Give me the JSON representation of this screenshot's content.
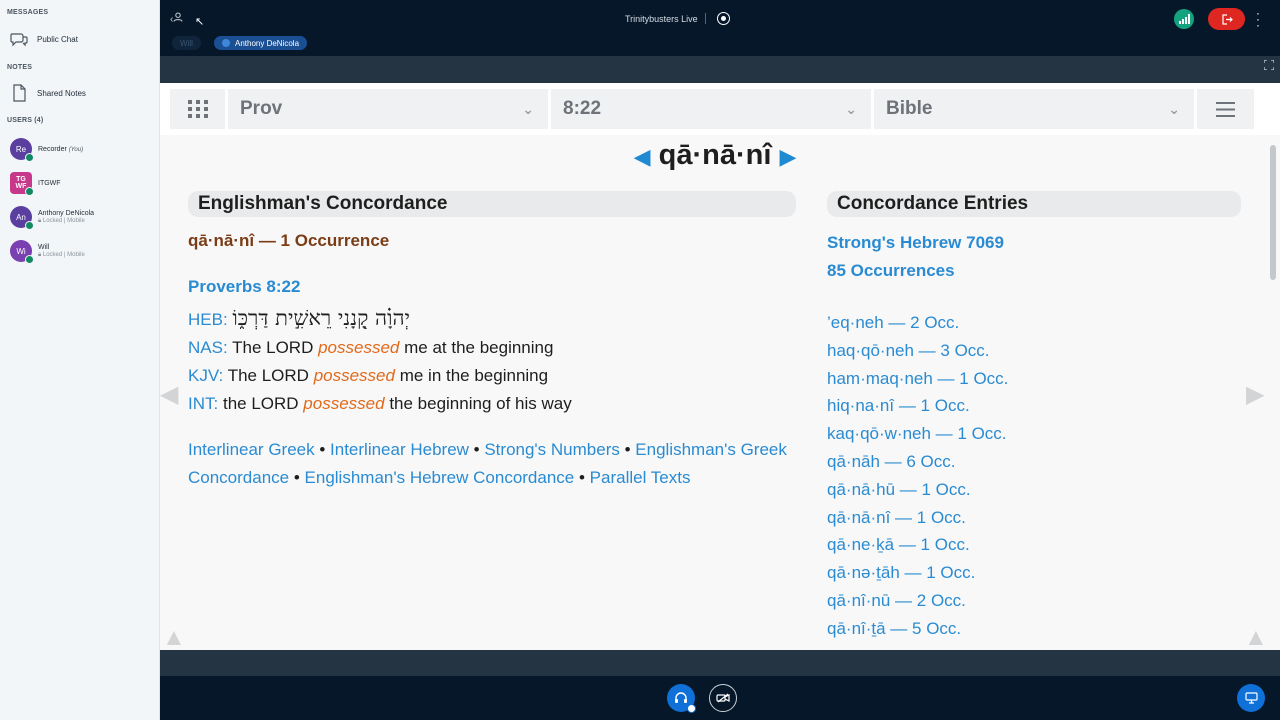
{
  "sidebar": {
    "messages_heading": "MESSAGES",
    "public_chat": "Public Chat",
    "notes_heading": "NOTES",
    "shared_notes": "Shared Notes",
    "users_heading": "USERS (4)",
    "users": [
      {
        "initials": "Re",
        "name": "Recorder",
        "tag": "(You)",
        "status": "",
        "color": "#5a3fa0"
      },
      {
        "initials": "ITGWF",
        "name": "ITGWF",
        "tag": "",
        "status": "",
        "color": "#c7378a"
      },
      {
        "initials": "An",
        "name": "Anthony DeNicola",
        "tag": "",
        "status": "Locked | Mobile",
        "color": "#5a3fa0"
      },
      {
        "initials": "Wi",
        "name": "Will",
        "tag": "",
        "status": "Locked | Mobile",
        "color": "#7a3fb0"
      }
    ]
  },
  "topbar": {
    "title": "Trinitybusters Live",
    "talkers": [
      "Will",
      "Anthony DeNicola"
    ]
  },
  "presentation": {
    "nav": {
      "book": "Prov",
      "verse": "8:22",
      "resource": "Bible"
    },
    "word": "qā·nā·nî",
    "left_section": "Englishman's Concordance",
    "occurrence_heading": "qā·nā·nî — 1 Occurrence",
    "reference": "Proverbs 8:22",
    "heb_label": "HEB:",
    "heb_text": "יְהוָ֗ה קָ֭נָנִי רֵאשִׁ֣ית דַּרְכּ֑וֹ",
    "nas_label": "NAS:",
    "nas_before": "The LORD",
    "nas_word": "possessed",
    "nas_after": "me at the beginning",
    "kjv_label": "KJV:",
    "kjv_before": "The LORD",
    "kjv_word": "possessed",
    "kjv_after": "me in the beginning",
    "int_label": "INT:",
    "int_before": "the LORD",
    "int_word": "possessed",
    "int_after": "the beginning of his way",
    "links": [
      "Interlinear Greek",
      "Interlinear Hebrew",
      "Strong's Numbers",
      "Englishman's Greek Concordance",
      "Englishman's Hebrew Concordance",
      "Parallel Texts"
    ],
    "right_section": "Concordance Entries",
    "strongs": "Strong's Hebrew 7069",
    "occurrences": "85 Occurrences",
    "entries": [
      "’eq·neh — 2 Occ.",
      "haq·qō·neh — 3 Occ.",
      "ham·maq·neh — 1 Occ.",
      "hiq·na·nî — 1 Occ.",
      "kaq·qō·w·neh — 1 Occ.",
      "qā·nāh — 6 Occ.",
      "qā·nā·hū — 1 Occ.",
      "qā·nā·nî — 1 Occ.",
      "qā·ne·ḵā — 1 Occ.",
      "qā·nə·ṯāh — 1 Occ.",
      "qā·nî·nū — 2 Occ.",
      "qā·nî·ṯā — 5 Occ."
    ]
  }
}
